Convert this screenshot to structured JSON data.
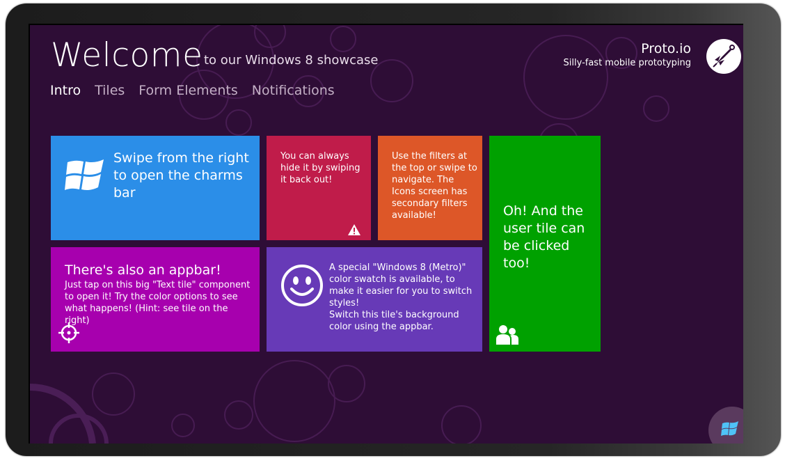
{
  "header": {
    "title": "Welcome",
    "subtitle": "to our Windows 8 showcase"
  },
  "nav": {
    "items": [
      {
        "label": "Intro",
        "active": true
      },
      {
        "label": "Tiles",
        "active": false
      },
      {
        "label": "Form Elements",
        "active": false
      },
      {
        "label": "Notifications",
        "active": false
      }
    ]
  },
  "brand": {
    "name": "Proto.io",
    "tagline": "Silly-fast mobile prototyping",
    "logo_icon": "rocket-logo-icon"
  },
  "tiles": {
    "charms": {
      "text": "Swipe from the right to open the charms bar",
      "icon": "windows-logo-icon",
      "color": "#2b8ee8"
    },
    "hide": {
      "text": "You can always hide it by swiping it back out!",
      "icon": "warning-icon",
      "color": "#c01c4a"
    },
    "filters": {
      "text": "Use the filters at the top or swipe to navigate. The Icons screen has secondary filters available!",
      "color": "#dd5728"
    },
    "user": {
      "text": "Oh! And the user tile can be clicked too!",
      "icon": "users-icon",
      "color": "#00a100"
    },
    "appbar": {
      "heading": "There's also an appbar!",
      "text": "Just tap on this big \"Text tile\" component to open it! Try the color options to see what happens! (Hint: see tile on the right)",
      "icon": "crosshair-icon",
      "color": "#a700ae"
    },
    "swatch": {
      "line1": "A special \"Windows 8 (Metro)\" color swatch is available, to make it easier for you to switch styles!",
      "line2": "Switch this tile's background color using the appbar.",
      "icon": "smiley-icon",
      "color": "#673ab7"
    }
  },
  "start_button": {
    "icon": "windows-start-icon"
  },
  "colors": {
    "background": "#2e0d36",
    "nav_inactive": "#c3afc5",
    "text": "#ffffff"
  }
}
